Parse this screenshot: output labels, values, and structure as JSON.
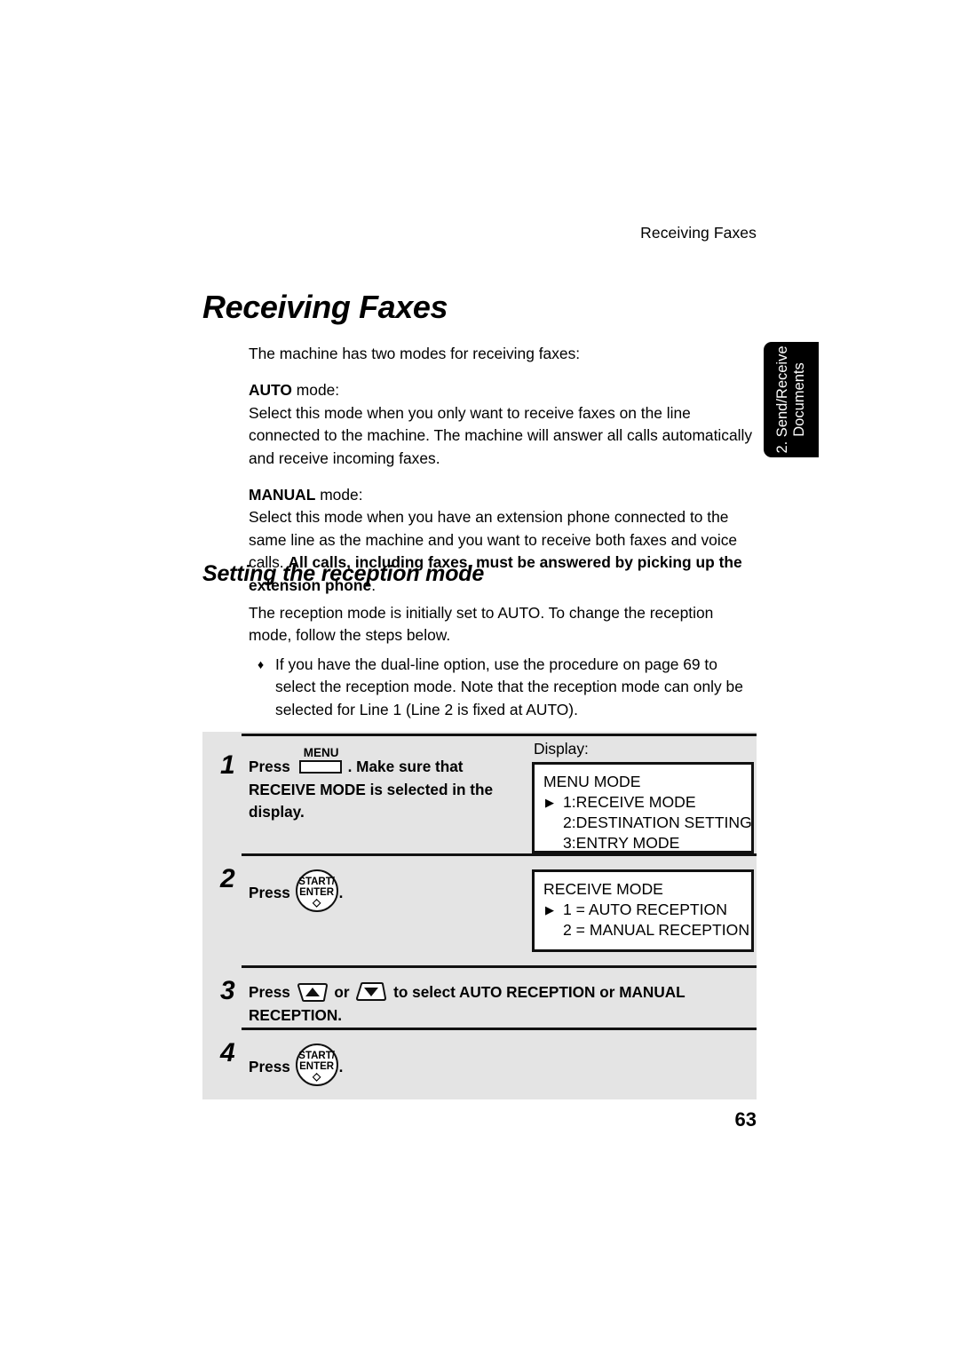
{
  "header": {
    "running_title": "Receiving Faxes"
  },
  "title": "Receiving Faxes",
  "intro": {
    "lead": "The machine has two modes for receiving faxes:",
    "auto_label": "AUTO",
    "auto_label_suffix": " mode:",
    "auto_text": "Select this mode when you only want to receive faxes on the line connected to the machine. The machine will answer all calls automatically and receive incoming faxes.",
    "manual_label": "MANUAL",
    "manual_label_suffix": " mode:",
    "manual_text_normal": "Select this mode when you have an extension phone connected to the same line as the machine and you want to receive both faxes and voice calls. ",
    "manual_text_bold": "All calls, including faxes, must be answered by picking up the extension phone",
    "manual_text_end": "."
  },
  "section": {
    "heading": "Setting the reception mode",
    "paragraph": "The reception mode is initially set to AUTO. To change the reception mode, follow the steps below.",
    "bullet_mark": "♦",
    "bullet_text": "If you have the dual-line option, use the procedure on page 69 to select the reception mode. Note that the reception mode can only be selected for Line 1 (Line 2 is fixed at AUTO)."
  },
  "side_tab": {
    "line1": "2. Send/Receive",
    "line2": "Documents"
  },
  "procedure": {
    "display_label": "Display:",
    "steps": [
      {
        "number": "1",
        "press_word": "Press",
        "key": "menu",
        "key_label": "MENU",
        "text_after": ". Make sure that RECEIVE MODE is selected in the display."
      },
      {
        "number": "2",
        "press_word": "Press",
        "key": "start-enter",
        "key_line1": "START/",
        "key_line2": "ENTER",
        "key_glyph": "◇",
        "text_after": "."
      },
      {
        "number": "3",
        "press_word": "Press",
        "key": "arrow-pair",
        "or_word": "or",
        "text_after": "to select AUTO RECEPTION or MANUAL RECEPTION."
      },
      {
        "number": "4",
        "press_word": "Press",
        "key": "start-enter",
        "key_line1": "START/",
        "key_line2": "ENTER",
        "key_glyph": "◇",
        "text_after": "."
      }
    ],
    "lcd1": {
      "title": "MENU MODE",
      "items": [
        "1:RECEIVE MODE",
        "2:DESTINATION SETTING",
        "3:ENTRY MODE"
      ]
    },
    "lcd2": {
      "title": "RECEIVE MODE",
      "items": [
        "1 = AUTO RECEPTION",
        "2 = MANUAL RECEPTION"
      ]
    }
  },
  "page_number": "63",
  "colors": {
    "panel_gray": "#e4e4e4",
    "rule_black": "#111111",
    "tab_black": "#000000",
    "text_black": "#000000"
  }
}
